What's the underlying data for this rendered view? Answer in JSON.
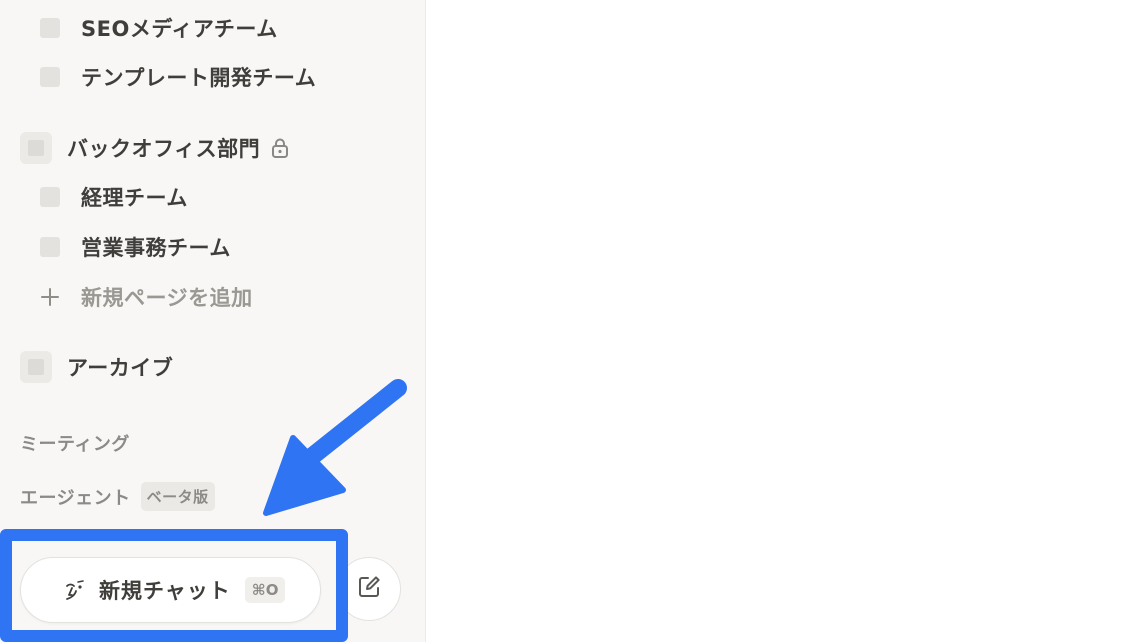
{
  "sidebar": {
    "items": [
      {
        "kind": "sub",
        "label": "SEOメディアチーム"
      },
      {
        "kind": "sub",
        "label": "テンプレート開発チーム"
      },
      {
        "kind": "top",
        "label": "バックオフィス部門",
        "locked": true
      },
      {
        "kind": "sub",
        "label": "経理チーム"
      },
      {
        "kind": "sub",
        "label": "営業事務チーム"
      },
      {
        "kind": "add",
        "label": "新規ページを追加"
      },
      {
        "kind": "top",
        "label": "アーカイブ"
      }
    ],
    "meetings_label": "ミーティング",
    "agents_label": "エージェント",
    "agents_badge": "ベータ版",
    "new_chat_label": "新規チャット",
    "new_chat_shortcut": "⌘O"
  },
  "icons": {
    "lock": "lock-icon",
    "plus": "plus-icon",
    "new_chat": "ai-face-icon",
    "compose": "compose-icon"
  },
  "annotation": {
    "highlight_color": "#2f74f2"
  }
}
